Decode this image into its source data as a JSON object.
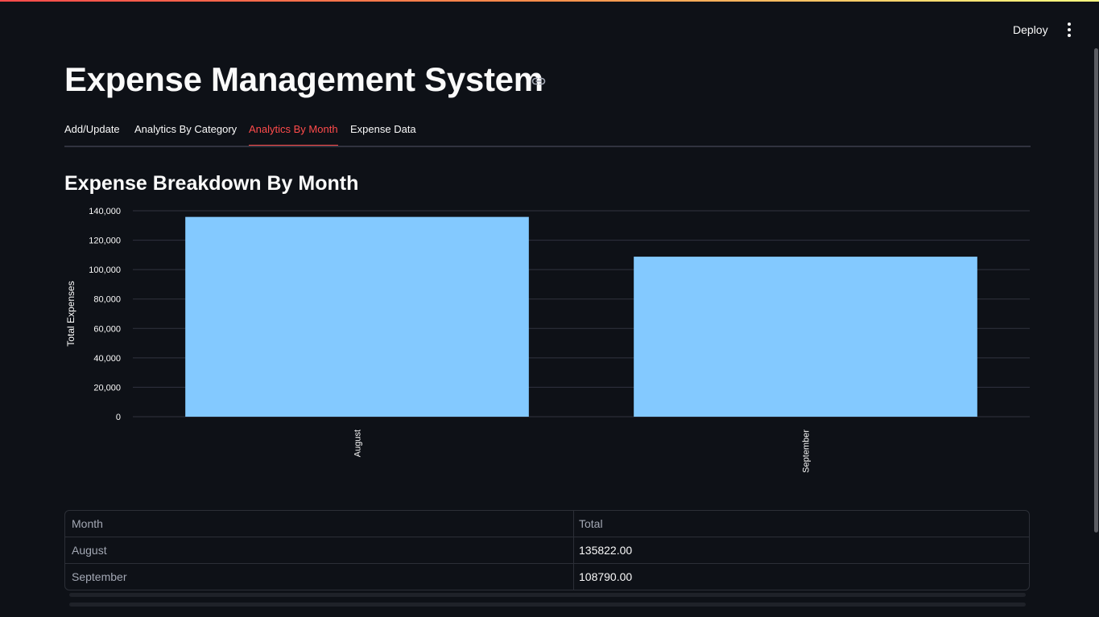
{
  "header": {
    "deploy_label": "Deploy",
    "menu_icon": "kebab-vertical-icon",
    "accent_gradient": [
      "#ff4b4b",
      "#ff8f4b",
      "#fffd80"
    ]
  },
  "page": {
    "title": "Expense Management System",
    "anchor_icon": "link-icon"
  },
  "tabs": [
    {
      "label": "Add/Update",
      "active": false
    },
    {
      "label": "Analytics By Category",
      "active": false
    },
    {
      "label": "Analytics By Month",
      "active": true
    },
    {
      "label": "Expense Data",
      "active": false
    }
  ],
  "section": {
    "subheader": "Expense Breakdown By Month"
  },
  "chart_data": {
    "type": "bar",
    "title": "",
    "xlabel": "",
    "ylabel": "Total Expenses",
    "categories": [
      "August",
      "September"
    ],
    "values": [
      135822,
      108790
    ],
    "ylim": [
      0,
      140000
    ],
    "yticks": [
      0,
      20000,
      40000,
      60000,
      80000,
      100000,
      120000,
      140000
    ],
    "ytick_labels": [
      "0",
      "20,000",
      "40,000",
      "60,000",
      "80,000",
      "100,000",
      "120,000",
      "140,000"
    ],
    "grid": true,
    "bar_color": "#83c9ff"
  },
  "table": {
    "columns": [
      "Month",
      "Total"
    ],
    "rows": [
      [
        "August",
        "135822.00"
      ],
      [
        "September",
        "108790.00"
      ]
    ]
  },
  "colors": {
    "background": "#0e1117",
    "text": "#fafafa",
    "accent": "#ff4b4b",
    "bar": "#83c9ff"
  }
}
